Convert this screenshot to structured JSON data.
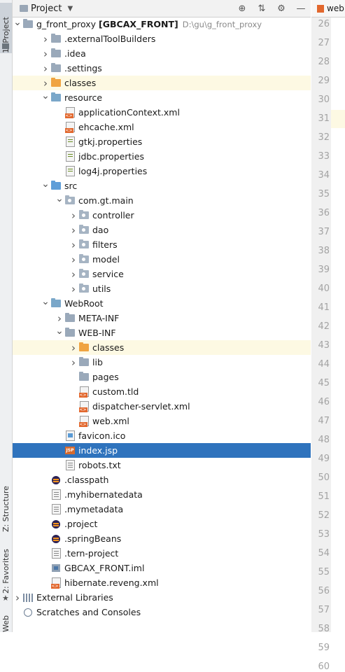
{
  "panel": {
    "title": "Project",
    "tools": [
      "locate-icon",
      "collapse-icon",
      "gear-icon",
      "hide-icon"
    ]
  },
  "side_tabs": {
    "project": "1: Project",
    "structure": "Z: Structure",
    "favorites": "2: Favorites",
    "web": "Web"
  },
  "editor": {
    "tab_label": "web",
    "line_numbers": [
      "26",
      "27",
      "28",
      "29",
      "30",
      "31",
      "32",
      "33",
      "34",
      "35",
      "36",
      "37",
      "38",
      "39",
      "40",
      "41",
      "42",
      "43",
      "44",
      "45",
      "46",
      "47",
      "48",
      "49",
      "50",
      "51",
      "52",
      "53",
      "54",
      "55",
      "56",
      "57",
      "58",
      "59",
      "60"
    ]
  },
  "tree": [
    {
      "label": "g_front_proxy",
      "bold_suffix": "[GBCAX_FRONT]",
      "path": "D:\\gu\\g_front_proxy",
      "depth": 0,
      "arrow": "open",
      "icon": "folder"
    },
    {
      "label": ".externalToolBuilders",
      "depth": 1,
      "arrow": "closed",
      "icon": "folder"
    },
    {
      "label": ".idea",
      "depth": 1,
      "arrow": "closed",
      "icon": "folder"
    },
    {
      "label": ".settings",
      "depth": 1,
      "arrow": "closed",
      "icon": "folder"
    },
    {
      "label": "classes",
      "depth": 1,
      "arrow": "closed",
      "icon": "folder-orange",
      "highlight": true
    },
    {
      "label": "resource",
      "depth": 1,
      "arrow": "open",
      "icon": "folder-teal"
    },
    {
      "label": "applicationContext.xml",
      "depth": 2,
      "arrow": "none",
      "icon": "xml"
    },
    {
      "label": "ehcache.xml",
      "depth": 2,
      "arrow": "none",
      "icon": "xml"
    },
    {
      "label": "gtkj.properties",
      "depth": 2,
      "arrow": "none",
      "icon": "prop"
    },
    {
      "label": "jdbc.properties",
      "depth": 2,
      "arrow": "none",
      "icon": "prop"
    },
    {
      "label": "log4j.properties",
      "depth": 2,
      "arrow": "none",
      "icon": "prop"
    },
    {
      "label": "src",
      "depth": 1,
      "arrow": "open",
      "icon": "folder-blue"
    },
    {
      "label": "com.gt.main",
      "depth": 2,
      "arrow": "open",
      "icon": "package"
    },
    {
      "label": "controller",
      "depth": 3,
      "arrow": "closed",
      "icon": "package"
    },
    {
      "label": "dao",
      "depth": 3,
      "arrow": "closed",
      "icon": "package"
    },
    {
      "label": "filters",
      "depth": 3,
      "arrow": "closed",
      "icon": "package"
    },
    {
      "label": "model",
      "depth": 3,
      "arrow": "closed",
      "icon": "package"
    },
    {
      "label": "service",
      "depth": 3,
      "arrow": "closed",
      "icon": "package"
    },
    {
      "label": "utils",
      "depth": 3,
      "arrow": "closed",
      "icon": "package"
    },
    {
      "label": "WebRoot",
      "depth": 1,
      "arrow": "open",
      "icon": "folder-web"
    },
    {
      "label": "META-INF",
      "depth": 2,
      "arrow": "closed",
      "icon": "folder"
    },
    {
      "label": "WEB-INF",
      "depth": 2,
      "arrow": "open",
      "icon": "folder"
    },
    {
      "label": "classes",
      "depth": 3,
      "arrow": "closed",
      "icon": "folder-orange",
      "highlight": true
    },
    {
      "label": "lib",
      "depth": 3,
      "arrow": "closed",
      "icon": "folder"
    },
    {
      "label": "pages",
      "depth": 3,
      "arrow": "none",
      "icon": "folder"
    },
    {
      "label": "custom.tld",
      "depth": 3,
      "arrow": "none",
      "icon": "tld"
    },
    {
      "label": "dispatcher-servlet.xml",
      "depth": 3,
      "arrow": "none",
      "icon": "xml"
    },
    {
      "label": "web.xml",
      "depth": 3,
      "arrow": "none",
      "icon": "xml"
    },
    {
      "label": "favicon.ico",
      "depth": 2,
      "arrow": "none",
      "icon": "ico"
    },
    {
      "label": "index.jsp",
      "depth": 2,
      "arrow": "none",
      "icon": "jsp",
      "selected": true
    },
    {
      "label": "robots.txt",
      "depth": 2,
      "arrow": "none",
      "icon": "txt"
    },
    {
      "label": ".classpath",
      "depth": 1,
      "arrow": "none",
      "icon": "eclipse"
    },
    {
      "label": ".myhibernatedata",
      "depth": 1,
      "arrow": "none",
      "icon": "txt"
    },
    {
      "label": ".mymetadata",
      "depth": 1,
      "arrow": "none",
      "icon": "txt"
    },
    {
      "label": ".project",
      "depth": 1,
      "arrow": "none",
      "icon": "eclipse"
    },
    {
      "label": ".springBeans",
      "depth": 1,
      "arrow": "none",
      "icon": "eclipse"
    },
    {
      "label": ".tern-project",
      "depth": 1,
      "arrow": "none",
      "icon": "txt"
    },
    {
      "label": "GBCAX_FRONT.iml",
      "depth": 1,
      "arrow": "none",
      "icon": "module"
    },
    {
      "label": "hibernate.reveng.xml",
      "depth": 1,
      "arrow": "none",
      "icon": "xml"
    },
    {
      "label": "External Libraries",
      "depth": 0,
      "arrow": "closed",
      "icon": "libs"
    },
    {
      "label": "Scratches and Consoles",
      "depth": 0,
      "arrow": "none",
      "icon": "scratch"
    }
  ]
}
